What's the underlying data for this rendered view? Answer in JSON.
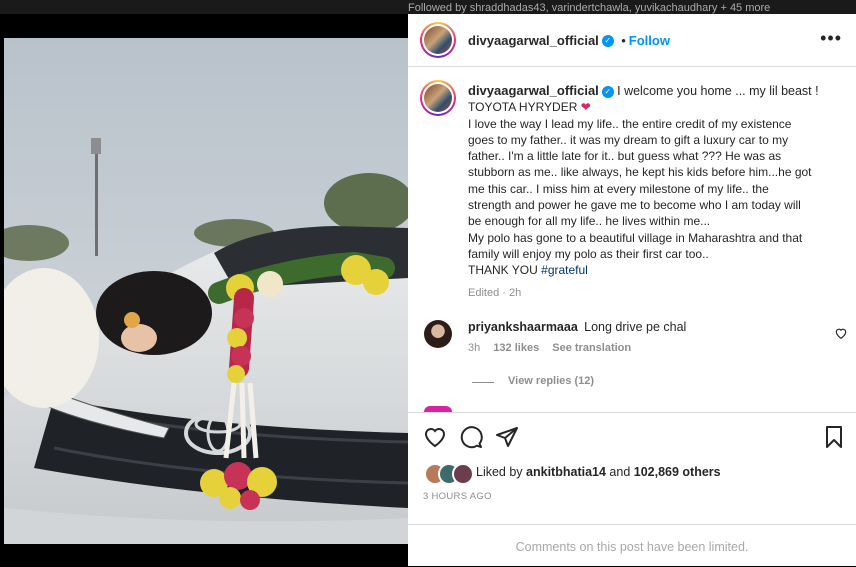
{
  "top_strip": {
    "text": "Followed by shraddhadas43, varindertchawla, yuvikachaudhary + 45 more"
  },
  "post": {
    "author": "divyaagarwal_official",
    "follow_label": "Follow",
    "more_label": "•••",
    "caption_lines": [
      "I welcome you home ... my lil beast !",
      "TOYOTA HYRYDER",
      "I love the way I lead my life.. the entire credit of my existence",
      "goes to my father.. it was my dream to gift a luxury car to my",
      "father.. I'm a little late for it.. but guess what ??? He was as",
      "stubborn as me.. like always, he kept his kids before him...he got",
      "me this car.. I miss him at every milestone of my life.. the",
      "strength and power he gave me to become who I am today will",
      "be enough for all my life.. he lives within me...",
      "My polo has gone to a beautiful village in Maharashtra and that",
      "family will enjoy my polo as their first car too..",
      "THANK YOU"
    ],
    "hashtag": "#grateful",
    "edited_label": "Edited",
    "edited_time": "2h"
  },
  "comment": {
    "username": "priyankshaarmaaa",
    "text": "Long drive pe chal",
    "time": "3h",
    "likes": "132 likes",
    "translate": "See translation",
    "view_replies": "View replies (12)"
  },
  "likes": {
    "prefix": "Liked by",
    "user": "ankitbhatia14",
    "middle": "and",
    "others": "102,869 others"
  },
  "time_ago": "3 HOURS AGO",
  "comments_limited": "Comments on this post have been limited.",
  "colors": {
    "accent": "#0095f6",
    "text": "#262626",
    "muted": "#8e8e8e",
    "heart": "#e0245e"
  }
}
